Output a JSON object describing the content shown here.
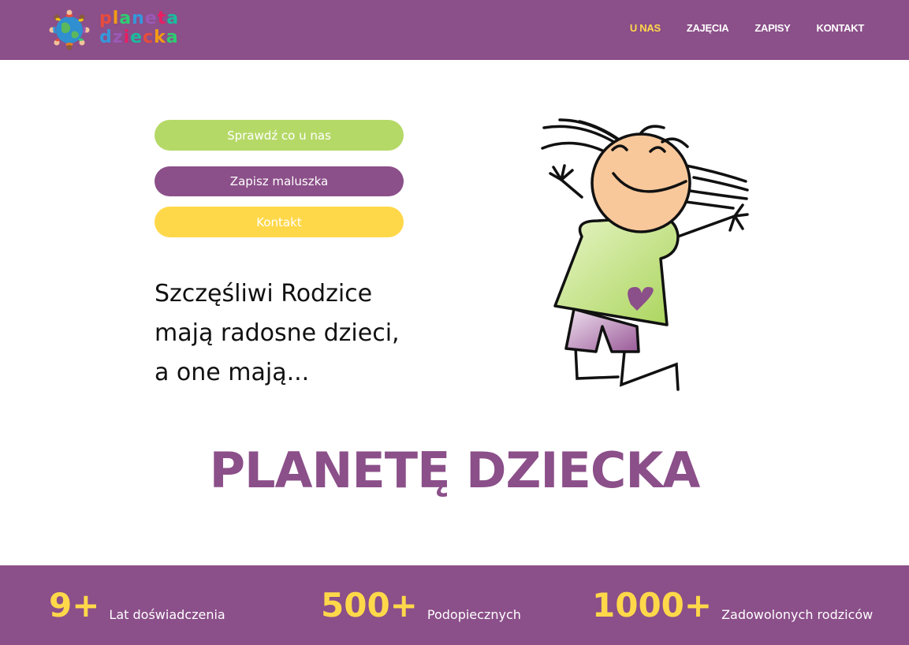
{
  "header": {
    "logo": {
      "icon": "globe-children-icon",
      "line1": "planeta",
      "line2": "dziecka"
    },
    "nav": [
      {
        "label": "U NAS",
        "active": true
      },
      {
        "label": "ZAJĘCIA",
        "active": false
      },
      {
        "label": "ZAPISY",
        "active": false
      },
      {
        "label": "KONTAKT",
        "active": false
      }
    ]
  },
  "hero": {
    "buttons": {
      "check": "Sprawdź co u nas",
      "enroll": "Zapisz maluszka",
      "contact": "Kontakt"
    },
    "tagline": [
      "Szczęśliwi Rodzice",
      "mają radosne dzieci,",
      "a one mają..."
    ],
    "illustration": "happy-child-illustration",
    "big_title": "PLANETĘ DZIECKA"
  },
  "stats": [
    {
      "value": "9+",
      "label": "Lat doświadczenia"
    },
    {
      "value": "500+",
      "label": "Podopiecznych"
    },
    {
      "value": "1000+",
      "label": "Zadowolonych rodziców"
    }
  ],
  "colors": {
    "brand_purple": "#8b4f89",
    "accent_yellow": "#ffd84a",
    "accent_green": "#b5d967",
    "white": "#ffffff"
  }
}
